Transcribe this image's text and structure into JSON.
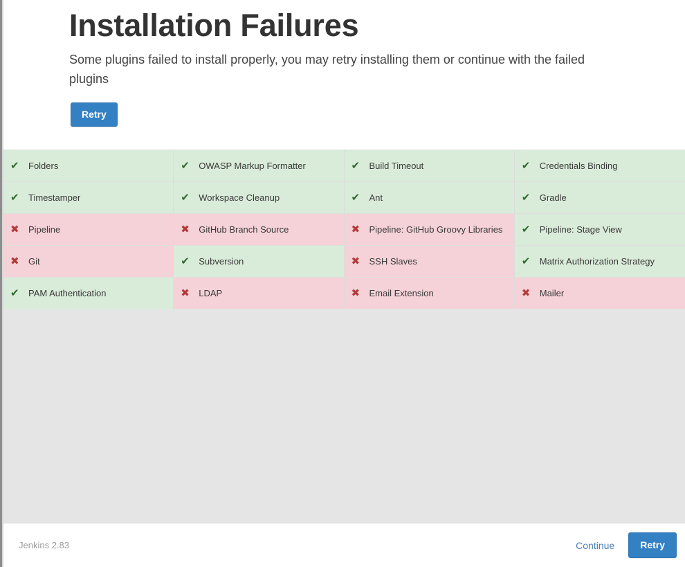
{
  "header": {
    "title": "Installation Failures",
    "description": "Some plugins failed to install properly, you may retry installing them or continue with the failed plugins",
    "retry_label": "Retry"
  },
  "icons": {
    "ok": "✔",
    "fail": "✖",
    "ok_name": "check-icon",
    "fail_name": "cross-icon"
  },
  "colors": {
    "accent": "#3380c3",
    "success_bg": "#d9ebd9",
    "failure_bg": "#f5d2d7",
    "success_icon": "#2d6b2d",
    "failure_icon": "#b33a3a",
    "link": "#4a7eb5",
    "page_bg": "#e5e5e5"
  },
  "plugins": [
    {
      "name": "Folders",
      "status": "ok"
    },
    {
      "name": "OWASP Markup Formatter",
      "status": "ok"
    },
    {
      "name": "Build Timeout",
      "status": "ok"
    },
    {
      "name": "Credentials Binding",
      "status": "ok"
    },
    {
      "name": "Timestamper",
      "status": "ok"
    },
    {
      "name": "Workspace Cleanup",
      "status": "ok"
    },
    {
      "name": "Ant",
      "status": "ok"
    },
    {
      "name": "Gradle",
      "status": "ok"
    },
    {
      "name": "Pipeline",
      "status": "fail"
    },
    {
      "name": "GitHub Branch Source",
      "status": "fail"
    },
    {
      "name": "Pipeline: GitHub Groovy Libraries",
      "status": "fail"
    },
    {
      "name": "Pipeline: Stage View",
      "status": "ok"
    },
    {
      "name": "Git",
      "status": "fail"
    },
    {
      "name": "Subversion",
      "status": "ok"
    },
    {
      "name": "SSH Slaves",
      "status": "fail"
    },
    {
      "name": "Matrix Authorization Strategy",
      "status": "ok"
    },
    {
      "name": "PAM Authentication",
      "status": "ok"
    },
    {
      "name": "LDAP",
      "status": "fail"
    },
    {
      "name": "Email Extension",
      "status": "fail"
    },
    {
      "name": "Mailer",
      "status": "fail"
    }
  ],
  "footer": {
    "version": "Jenkins 2.83",
    "continue_label": "Continue",
    "retry_label": "Retry"
  }
}
